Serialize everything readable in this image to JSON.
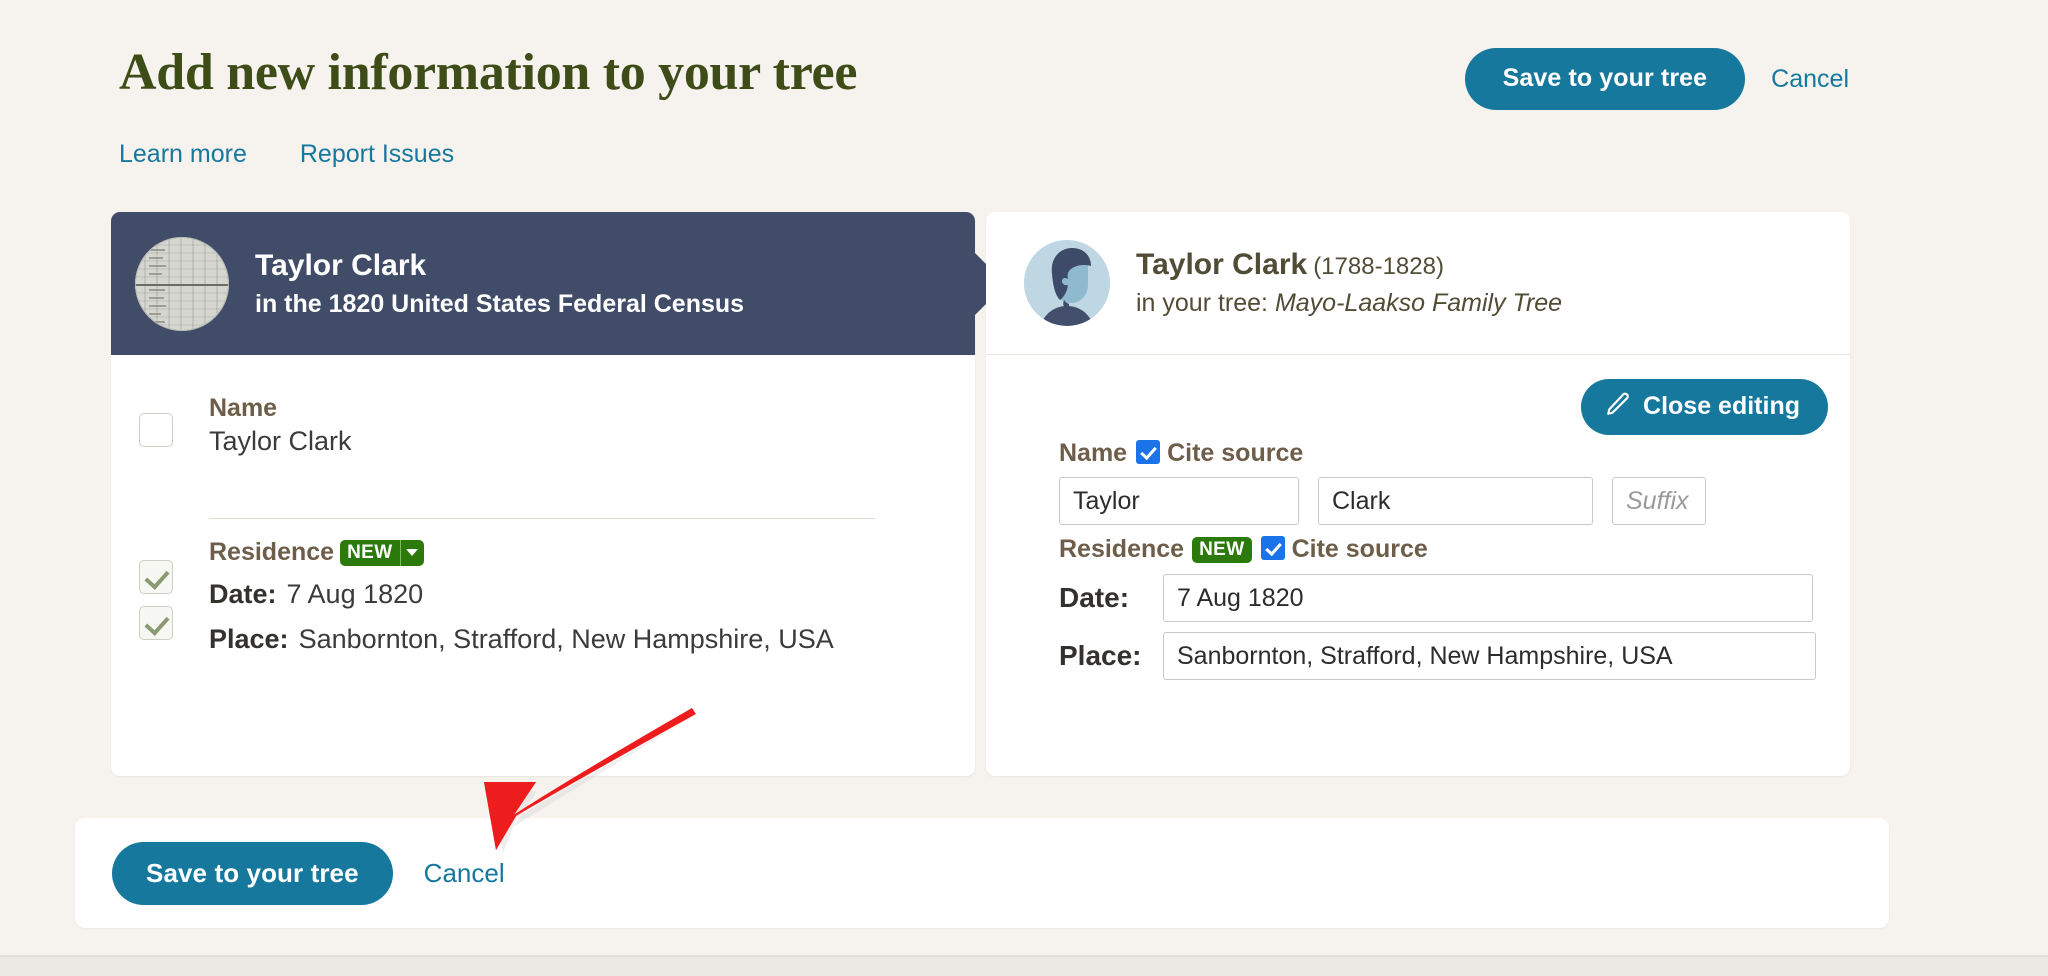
{
  "header": {
    "title": "Add new information to your tree",
    "save_label": "Save to your tree",
    "cancel_label": "Cancel"
  },
  "subnav": {
    "learn_more": "Learn more",
    "report_issues": "Report Issues"
  },
  "source_card": {
    "person_name": "Taylor Clark",
    "source_line": "in the 1820 United States Federal Census",
    "thumbnail_icon": "census-document-thumbnail",
    "name_section": {
      "label": "Name",
      "value": "Taylor Clark",
      "checked": false
    },
    "residence_section": {
      "label": "Residence",
      "badge": "NEW",
      "badge_caret_icon": "chevron-down-icon",
      "date_key": "Date:",
      "date_value": "7 Aug 1820",
      "date_checked": true,
      "place_key": "Place:",
      "place_value": "Sanbornton, Strafford, New Hampshire, USA",
      "place_checked": true
    }
  },
  "tree_card": {
    "person_name": "Taylor Clark",
    "life_years": "(1788-1828)",
    "tree_prefix": "in your tree: ",
    "tree_name": "Mayo-Laakso Family Tree",
    "avatar_icon": "person-silhouette-avatar",
    "close_editing_label": "Close editing",
    "pencil_icon": "pencil-icon",
    "name_section": {
      "label": "Name",
      "cite_label": "Cite source",
      "cite_checked": true,
      "first_name": "Taylor",
      "last_name": "Clark",
      "suffix_value": "",
      "suffix_placeholder": "Suffix"
    },
    "residence_section": {
      "label": "Residence",
      "badge": "NEW",
      "cite_label": "Cite source",
      "cite_checked": true,
      "date_key": "Date:",
      "date_value": "7 Aug 1820",
      "place_key": "Place:",
      "place_value": "Sanbornton, Strafford, New Hampshire, USA"
    }
  },
  "bottom_bar": {
    "save_label": "Save to your tree",
    "cancel_label": "Cancel"
  },
  "annotation": {
    "arrow_icon": "red-pointer-arrow",
    "arrow_color": "#ee1d1d"
  },
  "colors": {
    "page_background": "#f6f2ee",
    "title_green": "#3e4c18",
    "teal_accent": "#17789e",
    "navy_header": "#414c69",
    "badge_green": "#2b7a0b",
    "checkbox_blue": "#1a73e8",
    "label_brown": "#6d5d49"
  }
}
